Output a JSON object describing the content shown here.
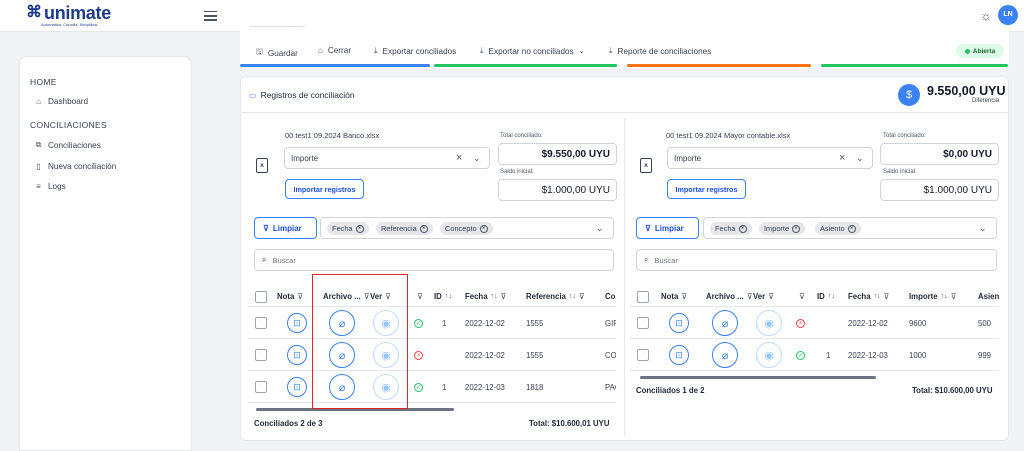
{
  "app": {
    "logo_mark": "⌘",
    "logo_text": "unimate",
    "logo_tagline": "Automatizá. Concilia. Simplificá.",
    "avatar_initials": "LN",
    "theme_icon": "sun-icon"
  },
  "sidebar": {
    "sections": [
      {
        "title": "HOME",
        "items": [
          {
            "label": "Dashboard",
            "icon": "home-icon"
          }
        ]
      },
      {
        "title": "CONCILIACIONES",
        "items": [
          {
            "label": "Conciliaciones",
            "icon": "copy-icon"
          },
          {
            "label": "Nueva conciliación",
            "icon": "file-icon"
          },
          {
            "label": "Logs",
            "icon": "list-icon"
          }
        ]
      }
    ]
  },
  "toolbar": {
    "save": "Guardar",
    "close": "Cerrar",
    "export_conciliated": "Exportar conciliados",
    "export_unconciliated": "Exportar no conciliados",
    "report": "Reporte de conciliaciones",
    "status": "Abierta",
    "colors": {
      "card1": "#3b82f6",
      "card2": "#22c55e",
      "card3": "#f97316",
      "card4": "#22c55e"
    }
  },
  "records": {
    "title": "Registros de conciliación",
    "difference_value": "9.550,00 UYU",
    "difference_label": "Diferencia"
  },
  "left": {
    "file": "00 test1 09.2024 Banco.xlsx",
    "select_value": "Importe",
    "import_button": "Importar registros",
    "total_label": "Total conciliado:",
    "total_value": "$9.550,00 UYU",
    "initial_label": "Saldo inicial:",
    "initial_value": "$1.000,00 UYU",
    "clear_button": "Limpiar",
    "chips": [
      "Fecha",
      "Referencia",
      "Concepto"
    ],
    "search_placeholder": "Buscar",
    "headers": {
      "nota": "Nota",
      "archivo": "Archivo ...",
      "ver": "Ver",
      "id": "ID",
      "fecha": "Fecha",
      "referencia": "Referencia",
      "concepto": "Co"
    },
    "rows": [
      {
        "status": "ok",
        "id": "1",
        "fecha": "2022-12-02",
        "referencia": "1555",
        "concepto": "GIR"
      },
      {
        "status": "bad",
        "id": "",
        "fecha": "2022-12-02",
        "referencia": "1555",
        "concepto": "CO"
      },
      {
        "status": "ok",
        "id": "1",
        "fecha": "2022-12-03",
        "referencia": "1818",
        "concepto": "PAC"
      }
    ],
    "footer_count": "Conciliados 2 de 3",
    "footer_total": "Total: $10.600,01 UYU"
  },
  "right": {
    "file": "00 test1 09.2024 Mayor contable.xlsx",
    "select_value": "Importe",
    "import_button": "Importar registros",
    "total_label": "Total conciliado:",
    "total_value": "$0,00 UYU",
    "initial_label": "Saldo inicial:",
    "initial_value": "$1.000,00 UYU",
    "clear_button": "Limpiar",
    "chips": [
      "Fecha",
      "Importe",
      "Asiento"
    ],
    "search_placeholder": "Buscar",
    "headers": {
      "nota": "Nota",
      "archivo": "Archivo ...",
      "ver": "Ver",
      "id": "ID",
      "fecha": "Fecha",
      "importe": "Importe",
      "asiento": "Asien"
    },
    "rows": [
      {
        "status": "bad",
        "id": "",
        "fecha": "2022-12-02",
        "importe": "9600",
        "asiento": "500"
      },
      {
        "status": "ok",
        "id": "1",
        "fecha": "2022-12-03",
        "importe": "1000",
        "asiento": "999"
      }
    ],
    "footer_count": "Conciliados 1 de 2",
    "footer_total": "Total: $10.600,00 UYU"
  }
}
